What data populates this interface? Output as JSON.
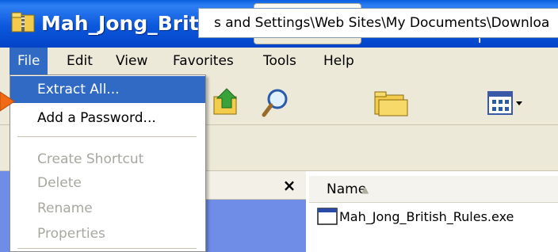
{
  "window": {
    "title": "Mah_Jong_British_Rules.zip"
  },
  "menubar": {
    "items": [
      "File",
      "Edit",
      "View",
      "Favorites",
      "Tools",
      "Help"
    ]
  },
  "file_menu": {
    "items": [
      {
        "label": "Extract All...",
        "enabled": true,
        "highlighted": true
      },
      {
        "label": "Add a Password...",
        "enabled": true
      },
      {
        "label": "Create Shortcut",
        "enabled": false
      },
      {
        "label": "Delete",
        "enabled": false
      },
      {
        "label": "Rename",
        "enabled": false
      },
      {
        "label": "Properties",
        "enabled": false
      }
    ]
  },
  "toolbar": {
    "search_label": "Search",
    "folders_label": "Folders"
  },
  "address": {
    "text": "s and Settings\\Web Sites\\My Documents\\Downloa"
  },
  "left_pane": {
    "close_label": "×"
  },
  "list": {
    "column_name": "Name",
    "files": [
      {
        "name": "Mah_Jong_British_Rules.exe"
      }
    ]
  },
  "colors": {
    "title_bar": "#0b58dc",
    "menu_highlight": "#316ac5",
    "menu_bar": "#ece9d8",
    "left_pane": "#6f8ce6"
  }
}
